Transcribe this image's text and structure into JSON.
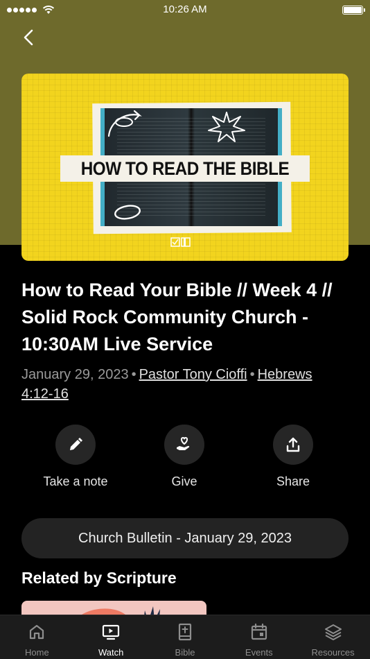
{
  "status_bar": {
    "time": "10:26 AM"
  },
  "hero": {
    "image_text": "HOW TO READ THE BIBLE",
    "accent_color": "#f2d41e"
  },
  "sermon": {
    "title": "How to Read Your Bible // Week 4 // Solid Rock Community Church - 10:30AM Live Service",
    "date": "January 29, 2023",
    "speaker": "Pastor Tony Cioffi",
    "scripture": "Hebrews 4:12-16"
  },
  "actions": {
    "note_label": "Take a note",
    "give_label": "Give",
    "share_label": "Share"
  },
  "bulletin": {
    "label": "Church Bulletin - January 29, 2023"
  },
  "related": {
    "heading": "Related by Scripture"
  },
  "tabs": [
    {
      "label": "Home",
      "icon": "home-icon",
      "active": false
    },
    {
      "label": "Watch",
      "icon": "tv-icon",
      "active": true
    },
    {
      "label": "Bible",
      "icon": "bible-icon",
      "active": false
    },
    {
      "label": "Events",
      "icon": "calendar-icon",
      "active": false
    },
    {
      "label": "Resources",
      "icon": "layers-icon",
      "active": false
    }
  ]
}
